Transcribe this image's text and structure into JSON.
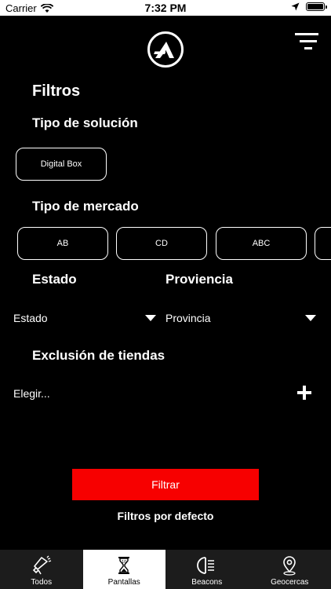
{
  "status_bar": {
    "carrier": "Carrier",
    "time": "7:32 PM"
  },
  "title": "Filtros",
  "solution": {
    "label": "Tipo de solución",
    "options": [
      "Digital Box"
    ]
  },
  "market": {
    "label": "Tipo de mercado",
    "options": [
      "AB",
      "CD",
      "ABC"
    ]
  },
  "state": {
    "label": "Estado",
    "value": "Estado"
  },
  "province": {
    "label": "Proviencia",
    "value": "Provincia"
  },
  "exclusion": {
    "label": "Exclusión de tiendas",
    "value": "Elegir..."
  },
  "actions": {
    "filter": "Filtrar",
    "default": "Filtros por defecto"
  },
  "tabs": [
    {
      "label": "Todos",
      "icon": "megaphone-icon"
    },
    {
      "label": "Pantallas",
      "icon": "hourglass-icon",
      "active": true
    },
    {
      "label": "Beacons",
      "icon": "beacon-icon"
    },
    {
      "label": "Geocercas",
      "icon": "location-pin-icon"
    }
  ],
  "colors": {
    "accent": "#f70000",
    "background": "#000000",
    "tabbar": "#1c1c1c"
  }
}
